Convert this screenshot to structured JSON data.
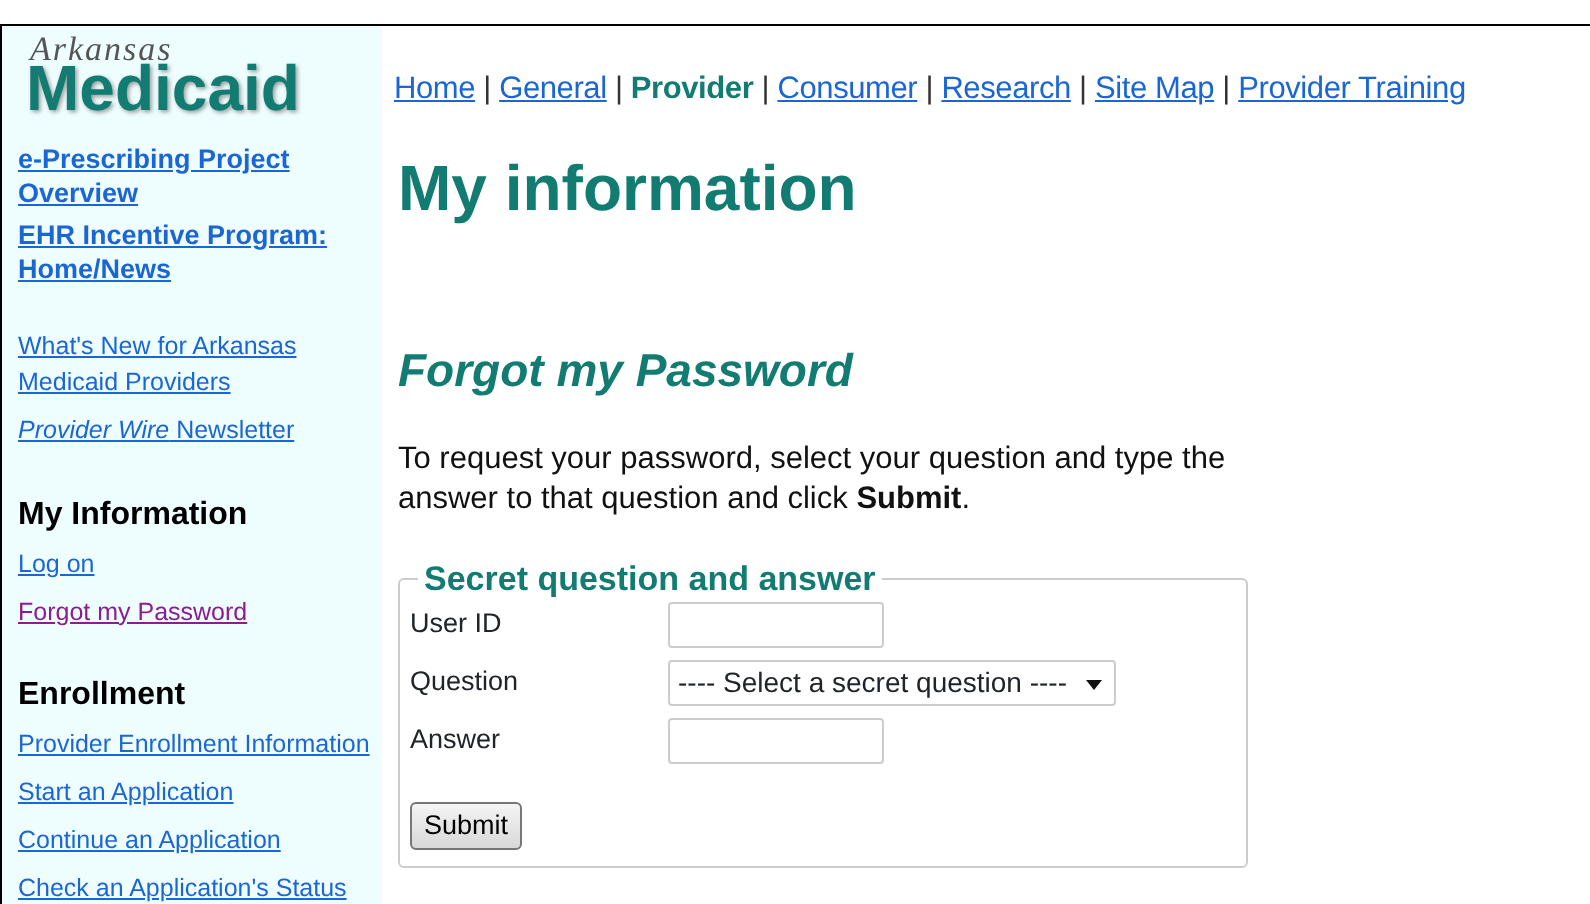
{
  "logo": {
    "top": "Arkansas",
    "main": "Medicaid"
  },
  "nav": [
    {
      "label": "Home",
      "selected": false
    },
    {
      "label": "General",
      "selected": false
    },
    {
      "label": "Provider",
      "selected": true
    },
    {
      "label": "Consumer",
      "selected": false
    },
    {
      "label": "Research",
      "selected": false
    },
    {
      "label": "Site Map",
      "selected": false
    },
    {
      "label": "Provider Training",
      "selected": false
    }
  ],
  "nav_separator": "|",
  "sidebar": [
    {
      "kind": "featured",
      "links": [
        {
          "label": "e-Prescribing Project Overview",
          "visited": false
        },
        {
          "label": "EHR Incentive Program: Home/News",
          "visited": false
        }
      ]
    },
    {
      "kind": "news",
      "links": [
        {
          "label": "What's New for Arkansas Medicaid Providers",
          "visited": false
        },
        {
          "label": "*Provider Wire* Newsletter",
          "visited": false
        }
      ]
    },
    {
      "kind": "section",
      "heading": "My Information",
      "links": [
        {
          "label": "Log on",
          "visited": false
        },
        {
          "label": "Forgot my Password",
          "visited": true
        }
      ]
    },
    {
      "kind": "section",
      "heading": "Enrollment",
      "links": [
        {
          "label": "Provider Enrollment Information",
          "visited": false
        },
        {
          "label": "Start an Application",
          "visited": false
        },
        {
          "label": "Continue an Application",
          "visited": false
        },
        {
          "label": "Check an Application's Status",
          "visited": false
        }
      ]
    }
  ],
  "main": {
    "title": "My information",
    "subtitle": "Forgot my Password",
    "instructions": "To request your password, select your question and type the answer to that question and click  **Submit**.",
    "form": {
      "legend": "Secret question and answer",
      "fields": [
        {
          "label": "User ID",
          "kind": "text"
        },
        {
          "label": "Question",
          "kind": "select",
          "value": "---- Select a secret question ----"
        },
        {
          "label": "Answer",
          "kind": "text"
        }
      ],
      "button": "Submit"
    }
  }
}
